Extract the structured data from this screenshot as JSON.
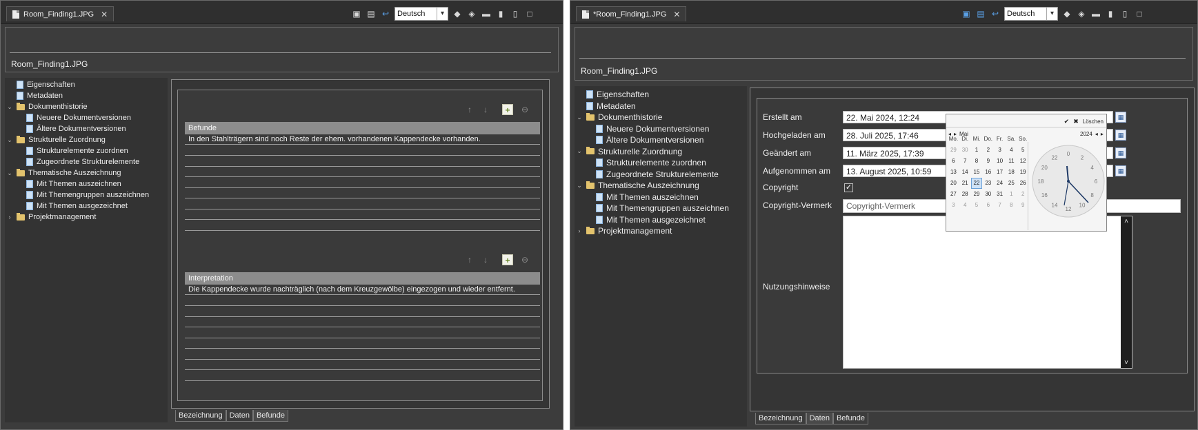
{
  "left": {
    "tab_title": "Room_Finding1.JPG",
    "language": "Deutsch",
    "doc_title": "Room_Finding1.JPG",
    "tree": [
      {
        "label": "Eigenschaften",
        "kind": "page",
        "level": 0
      },
      {
        "label": "Metadaten",
        "kind": "page",
        "level": 0
      },
      {
        "label": "Dokumenthistorie",
        "kind": "folder-open",
        "level": 0
      },
      {
        "label": "Neuere Dokumentversionen",
        "kind": "page",
        "level": 1
      },
      {
        "label": "Ältere Dokumentversionen",
        "kind": "page",
        "level": 1
      },
      {
        "label": "Strukturelle Zuordnung",
        "kind": "folder-open",
        "level": 0
      },
      {
        "label": "Strukturelemente zuordnen",
        "kind": "page",
        "level": 1
      },
      {
        "label": "Zugeordnete Strukturelemente",
        "kind": "page",
        "level": 1
      },
      {
        "label": "Thematische Auszeichnung",
        "kind": "folder-open",
        "level": 0
      },
      {
        "label": "Mit Themen auszeichnen",
        "kind": "page",
        "level": 1
      },
      {
        "label": "Mit Themengruppen auszeichnen",
        "kind": "page",
        "level": 1
      },
      {
        "label": "Mit Themen ausgezeichnet",
        "kind": "page",
        "level": 1
      },
      {
        "label": "Projektmanagement",
        "kind": "folder-closed",
        "level": 0
      }
    ],
    "befunde": {
      "header": "Befunde",
      "row": "In den Stahlträgern sind noch Reste der ehem. vorhandenen Kappendecke vorhanden."
    },
    "interpretation": {
      "header": "Interpretation",
      "row": "Die Kappendecke wurde nachträglich (nach dem Kreuzgewölbe) eingezogen und wieder entfernt."
    },
    "bottom_tabs": [
      "Bezeichnung",
      "Daten",
      "Befunde"
    ]
  },
  "right": {
    "tab_title": "*Room_Finding1.JPG",
    "language": "Deutsch",
    "doc_title": "Room_Finding1.JPG",
    "fields": [
      {
        "label": "Erstellt am",
        "value": "22. Mai 2024, 12:24"
      },
      {
        "label": "Hochgeladen am",
        "value": "28. Juli 2025, 17:46"
      },
      {
        "label": "Geändert am",
        "value": "11. März 2025, 17:39"
      },
      {
        "label": "Aufgenommen am",
        "value": "13. August 2025, 10:59"
      }
    ],
    "copyright_label": "Copyright",
    "copyright_checked": true,
    "copyright_note_label": "Copyright-Vermerk",
    "copyright_note_placeholder": "Copyright-Vermerk",
    "usage_label": "Nutzungshinweise",
    "bottom_tabs": [
      "Bezeichnung",
      "Daten",
      "Befunde"
    ],
    "calendar": {
      "month": "Mai",
      "year": "2024",
      "clear_label": "Löschen",
      "weekdays": [
        "Mo.",
        "Di.",
        "Mi.",
        "Do.",
        "Fr.",
        "Sa.",
        "So."
      ],
      "weeks": [
        [
          "29",
          "30",
          "1",
          "2",
          "3",
          "4",
          "5"
        ],
        [
          "6",
          "7",
          "8",
          "9",
          "10",
          "11",
          "12"
        ],
        [
          "13",
          "14",
          "15",
          "16",
          "17",
          "18",
          "19"
        ],
        [
          "20",
          "21",
          "22",
          "23",
          "24",
          "25",
          "26"
        ],
        [
          "27",
          "28",
          "29",
          "30",
          "31",
          "1",
          "2"
        ],
        [
          "3",
          "4",
          "5",
          "6",
          "7",
          "8",
          "9"
        ]
      ],
      "selected_day": "22",
      "clock_numbers": [
        "0",
        "2",
        "4",
        "6",
        "8",
        "10",
        "12",
        "14",
        "16",
        "18",
        "20",
        "22"
      ]
    }
  }
}
